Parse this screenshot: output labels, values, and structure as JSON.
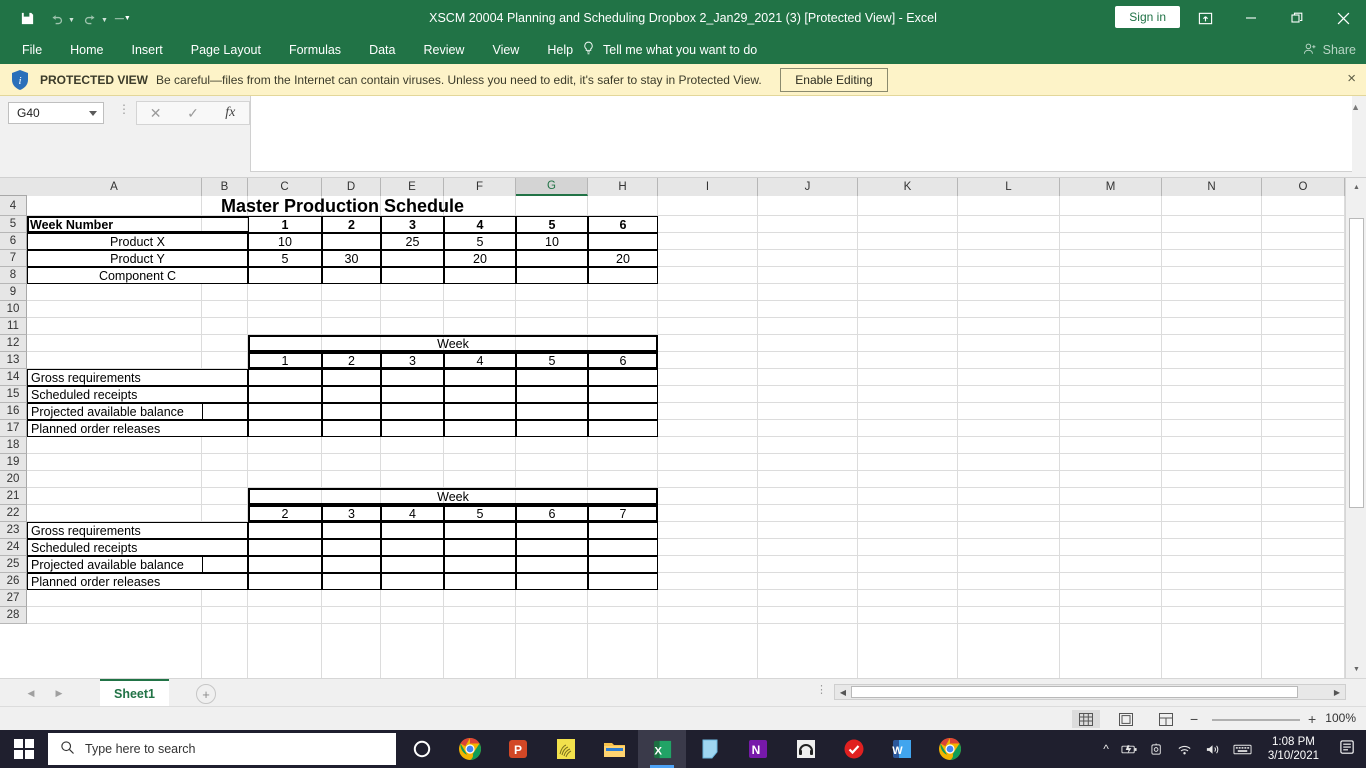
{
  "titlebar": {
    "document_title": "XSCM 20004 Planning and Scheduling Dropbox 2_Jan29_2021 (3)  [Protected View]  -  Excel",
    "save_icon": "save-icon",
    "undo_icon": "undo-icon",
    "redo_icon": "redo-icon",
    "customize_icon": "customize-quick-access-icon",
    "signin_label": "Sign in",
    "ribbon_display_icon": "ribbon-display-options-icon",
    "minimize_icon": "minimize-icon",
    "restore_icon": "restore-icon",
    "close_icon": "close-icon"
  },
  "ribbon": {
    "tabs": [
      {
        "label": "File"
      },
      {
        "label": "Home"
      },
      {
        "label": "Insert"
      },
      {
        "label": "Page Layout"
      },
      {
        "label": "Formulas"
      },
      {
        "label": "Data"
      },
      {
        "label": "Review"
      },
      {
        "label": "View"
      },
      {
        "label": "Help"
      }
    ],
    "tellme_placeholder": "Tell me what you want to do",
    "tellme_icon": "lightbulb-icon",
    "share_label": "Share",
    "share_icon": "share-person-icon"
  },
  "protected_view": {
    "shield_icon": "shield-info-icon",
    "label": "PROTECTED VIEW",
    "message": "Be careful—files from the Internet can contain viruses. Unless you need to edit, it's safer to stay in Protected View.",
    "enable_button": "Enable Editing",
    "close_icon": "close-icon"
  },
  "formula_bar": {
    "name_box_value": "G40",
    "name_box_caret_icon": "chevron-down-icon",
    "cancel_icon": "cancel-icon",
    "confirm_icon": "check-icon",
    "function_icon": "fx",
    "formula_value": "",
    "expand_icon": "expand-formula-bar-icon"
  },
  "grid": {
    "columns": [
      "A",
      "B",
      "C",
      "D",
      "E",
      "F",
      "G",
      "H",
      "I",
      "J",
      "K",
      "L",
      "M",
      "N",
      "O"
    ],
    "selected_column": "G",
    "rows": [
      "4",
      "5",
      "6",
      "7",
      "8",
      "9",
      "10",
      "11",
      "12",
      "13",
      "14",
      "15",
      "16",
      "17",
      "18",
      "19",
      "20",
      "21",
      "22",
      "23",
      "24",
      "25",
      "26",
      "27",
      "28"
    ],
    "colors": {
      "highlight": "#ffff00",
      "accent": "#217346"
    }
  },
  "sheet_data": {
    "mps": {
      "title": "Master Production Schedule",
      "row_label_header": "Week Number",
      "week_numbers": [
        "1",
        "2",
        "3",
        "4",
        "5",
        "6"
      ],
      "rows": [
        {
          "label": "Product X",
          "values": [
            "10",
            "",
            "25",
            "5",
            "10",
            ""
          ],
          "highlighted": false
        },
        {
          "label": "Product Y",
          "values": [
            "5",
            "30",
            "",
            "20",
            "",
            "20"
          ],
          "highlighted": false
        },
        {
          "label": "Component C",
          "values": [
            "",
            "",
            "",
            "",
            "",
            ""
          ],
          "highlighted": true
        }
      ]
    },
    "mrp_tables": [
      {
        "header": "Week",
        "week_numbers": [
          "1",
          "2",
          "3",
          "4",
          "5",
          "6"
        ],
        "rows": [
          {
            "label": "Gross requirements",
            "values": [
              "",
              "",
              "",
              "",
              "",
              ""
            ],
            "prior_cell": false
          },
          {
            "label": "Scheduled receipts",
            "values": [
              "",
              "",
              "",
              "",
              "",
              ""
            ],
            "prior_cell": false
          },
          {
            "label": "Projected available balance",
            "values": [
              "",
              "",
              "",
              "",
              "",
              ""
            ],
            "prior_cell": true
          },
          {
            "label": "Planned order releases",
            "values": [
              "",
              "",
              "",
              "",
              "",
              ""
            ],
            "prior_cell": false
          }
        ]
      },
      {
        "header": "Week",
        "week_numbers": [
          "2",
          "3",
          "4",
          "5",
          "6",
          "7"
        ],
        "rows": [
          {
            "label": "Gross requirements",
            "values": [
              "",
              "",
              "",
              "",
              "",
              ""
            ],
            "prior_cell": false
          },
          {
            "label": "Scheduled receipts",
            "values": [
              "",
              "",
              "",
              "",
              "",
              ""
            ],
            "prior_cell": false
          },
          {
            "label": "Projected available balance",
            "values": [
              "",
              "",
              "",
              "",
              "",
              ""
            ],
            "prior_cell": true
          },
          {
            "label": "Planned order releases",
            "values": [
              "",
              "",
              "",
              "",
              "",
              ""
            ],
            "prior_cell": false
          }
        ]
      }
    ]
  },
  "sheet_tabs": {
    "prev_icon": "previous-sheet-icon",
    "next_icon": "next-sheet-icon",
    "tabs": [
      {
        "label": "Sheet1",
        "active": true
      }
    ],
    "add_sheet_icon": "add-sheet-icon"
  },
  "status_bar": {
    "normal_view_icon": "normal-view-icon",
    "page_layout_icon": "page-layout-view-icon",
    "page_break_icon": "page-break-preview-icon",
    "zoom_out_label": "−",
    "zoom_in_label": "+",
    "zoom_level": "100%"
  },
  "taskbar": {
    "start_icon": "windows-start-icon",
    "search_placeholder": "Type here to search",
    "search_icon": "search-icon",
    "apps": [
      {
        "name": "cortana-icon"
      },
      {
        "name": "chrome-icon"
      },
      {
        "name": "powerpoint-icon"
      },
      {
        "name": "thumbprint-icon"
      },
      {
        "name": "file-explorer-icon"
      },
      {
        "name": "excel-icon",
        "active": true
      },
      {
        "name": "sticky-notes-icon"
      },
      {
        "name": "onenote-icon"
      },
      {
        "name": "audacity-icon"
      },
      {
        "name": "checkmark-icon"
      },
      {
        "name": "word-icon"
      },
      {
        "name": "chrome-icon-2"
      }
    ],
    "tray": [
      {
        "name": "show-hidden-icons-icon"
      },
      {
        "name": "battery-icon"
      },
      {
        "name": "camera-icon"
      },
      {
        "name": "wifi-icon"
      },
      {
        "name": "volume-icon"
      },
      {
        "name": "keyboard-icon"
      }
    ],
    "time": "1:08 PM",
    "date": "3/10/2021",
    "notification_icon": "notifications-icon"
  }
}
